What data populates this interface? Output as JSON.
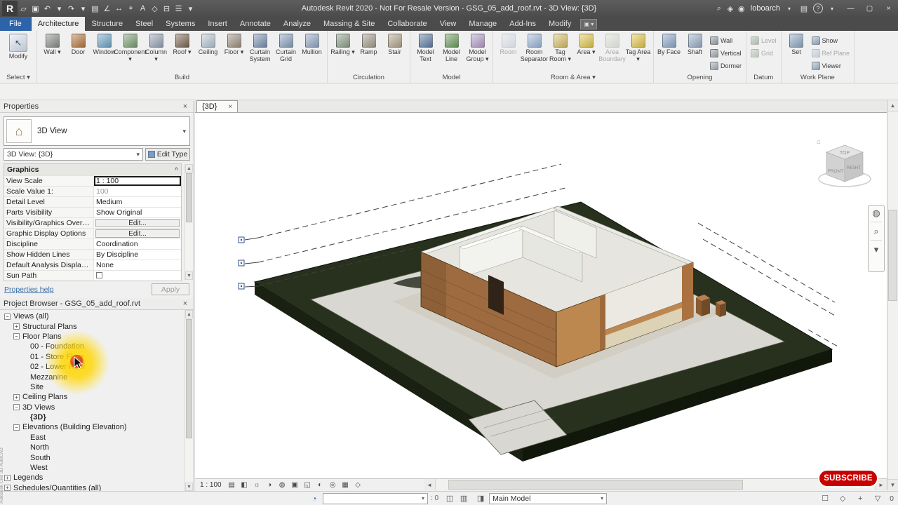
{
  "title_bar": {
    "title": "Autodesk Revit 2020 - Not For Resale Version - GSG_05_add_roof.rvt - 3D View: {3D}",
    "user": "loboarch",
    "qat": [
      {
        "name": "revit-menu-icon",
        "glyph": "R"
      },
      {
        "name": "open-icon",
        "glyph": "▱"
      },
      {
        "name": "save-icon",
        "glyph": "▣"
      },
      {
        "name": "undo-icon",
        "glyph": "↶"
      },
      {
        "name": "undo-dropdown-icon",
        "glyph": "▾"
      },
      {
        "name": "redo-icon",
        "glyph": "↷"
      },
      {
        "name": "redo-dropdown-icon",
        "glyph": "▾"
      },
      {
        "name": "print-icon",
        "glyph": "▤"
      },
      {
        "name": "measure-icon",
        "glyph": "∠"
      },
      {
        "name": "aligned-dimension-icon",
        "glyph": "↔"
      },
      {
        "name": "tag-icon",
        "glyph": "⌖"
      },
      {
        "name": "text-icon",
        "glyph": "A"
      },
      {
        "name": "default-3d-view-icon",
        "glyph": "◇"
      },
      {
        "name": "section-icon",
        "glyph": "⊟"
      },
      {
        "name": "thin-lines-icon",
        "glyph": "☰"
      },
      {
        "name": "qat-customize-icon",
        "glyph": "▾"
      }
    ],
    "right_icons": [
      {
        "name": "search-icon",
        "glyph": "⌕"
      },
      {
        "name": "communication-center-icon",
        "glyph": "◈"
      },
      {
        "name": "user-icon",
        "glyph": "◉"
      }
    ],
    "user_dropdown_glyph": "▾",
    "store_icon_glyph": "▤",
    "help_glyph": "?",
    "help_dropdown_glyph": "▾",
    "window_controls": [
      {
        "name": "minimize-button",
        "glyph": "—"
      },
      {
        "name": "maximize-button",
        "glyph": "▢"
      },
      {
        "name": "close-button",
        "glyph": "×"
      }
    ]
  },
  "ribbon": {
    "tabs": [
      "File",
      "Architecture",
      "Structure",
      "Steel",
      "Systems",
      "Insert",
      "Annotate",
      "Analyze",
      "Massing & Site",
      "Collaborate",
      "View",
      "Manage",
      "Add-Ins",
      "Modify"
    ],
    "active_tab": "Architecture",
    "panels": [
      {
        "label": "Select",
        "arrow": true,
        "items": [
          {
            "label": "Modify",
            "ic": "#dce6f2",
            "glyph": "↖",
            "wide": true
          }
        ]
      },
      {
        "label": "Build",
        "items": [
          {
            "label": "Wall",
            "arrow": true,
            "ic": "#8a8f8a"
          },
          {
            "label": "Door",
            "ic": "#b5793f"
          },
          {
            "label": "Window",
            "ic": "#6fa7c7"
          },
          {
            "label": "Component",
            "arrow": true,
            "ic": "#7a9f72"
          },
          {
            "label": "Column",
            "arrow": true,
            "ic": "#98a4b8"
          },
          {
            "label": "Roof",
            "arrow": true,
            "ic": "#7c6752"
          },
          {
            "label": "Ceiling",
            "ic": "#b9c7d4"
          },
          {
            "label": "Floor",
            "arrow": true,
            "ic": "#a09182"
          },
          {
            "label": "Curtain System",
            "ic": "#7b93b4"
          },
          {
            "label": "Curtain Grid",
            "ic": "#8aa3c0"
          },
          {
            "label": "Mullion",
            "ic": "#93a9c4"
          }
        ]
      },
      {
        "label": "Circulation",
        "items": [
          {
            "label": "Railing",
            "arrow": true,
            "ic": "#8fa08d"
          },
          {
            "label": "Ramp",
            "ic": "#a59d8f"
          },
          {
            "label": "Stair",
            "ic": "#b3a88e"
          }
        ]
      },
      {
        "label": "Model",
        "items": [
          {
            "label": "Model Text",
            "ic": "#5f7fa5"
          },
          {
            "label": "Model Line",
            "ic": "#6f9f5f"
          },
          {
            "label": "Model Group",
            "arrow": true,
            "ic": "#b59fc9"
          }
        ]
      },
      {
        "label": "Room & Area",
        "arrow": true,
        "items": [
          {
            "label": "Room",
            "gray": true,
            "ic": "#cdd8e8"
          },
          {
            "label": "Room Separator",
            "ic": "#9fb9da"
          },
          {
            "label": "Tag Room",
            "arrow": true,
            "ic": "#d9c06a"
          },
          {
            "label": "Area",
            "arrow": true,
            "ic": "#e3c94f"
          },
          {
            "label": "Area Boundary",
            "gray": true,
            "ic": "#c9d4c2"
          },
          {
            "label": "Tag Area",
            "arrow": true,
            "ic": "#e3c94f"
          }
        ]
      },
      {
        "label": "Opening",
        "items": [
          {
            "label": "By Face",
            "ic": "#8fa9c9"
          },
          {
            "label": "Shaft",
            "ic": "#9ab1c9"
          },
          {
            "type": "stack",
            "items": [
              {
                "label": "Wall",
                "ic": "#9aa5ad"
              },
              {
                "label": "Vertical",
                "ic": "#a3adb5"
              },
              {
                "label": "Dormer",
                "ic": "#aab3ba"
              }
            ]
          }
        ]
      },
      {
        "label": "Datum",
        "items": [
          {
            "type": "stack",
            "items": [
              {
                "label": "Level",
                "gray": true,
                "ic": "#6f8f6f"
              },
              {
                "label": "Grid",
                "gray": true,
                "ic": "#8fa98f"
              }
            ]
          }
        ]
      },
      {
        "label": "Work Plane",
        "items": [
          {
            "label": "Set",
            "ic": "#92aac4"
          },
          {
            "type": "stack",
            "items": [
              {
                "label": "Show",
                "ic": "#9fb5cc"
              },
              {
                "label": "Ref Plane",
                "gray": true,
                "ic": "#aebecf"
              },
              {
                "label": "Viewer",
                "ic": "#a5bacf"
              }
            ]
          }
        ]
      }
    ]
  },
  "properties": {
    "header": "Properties",
    "type_selector_label": "3D View",
    "instance_value": "3D View: {3D}",
    "edit_type_label": "Edit Type",
    "group_header": "Graphics",
    "group_collapse_glyph": "^",
    "rows": [
      {
        "label": "View Scale",
        "value": "1 : 100",
        "type": "selected"
      },
      {
        "label": "Scale Value    1:",
        "value": "100",
        "type": "disabled"
      },
      {
        "label": "Detail Level",
        "value": "Medium",
        "type": "text"
      },
      {
        "label": "Parts Visibility",
        "value": "Show Original",
        "type": "text"
      },
      {
        "label": "Visibility/Graphics Overrides",
        "value": "Edit...",
        "type": "button"
      },
      {
        "label": "Graphic Display Options",
        "value": "Edit...",
        "type": "button"
      },
      {
        "label": "Discipline",
        "value": "Coordination",
        "type": "text"
      },
      {
        "label": "Show Hidden Lines",
        "value": "By Discipline",
        "type": "text"
      },
      {
        "label": "Default Analysis Display St...",
        "value": "None",
        "type": "text"
      },
      {
        "label": "Sun Path",
        "value": "",
        "type": "checkbox"
      }
    ],
    "help_link": "Properties help",
    "apply_label": "Apply"
  },
  "project_browser": {
    "header": "Project Browser - GSG_05_add_roof.rvt",
    "items": [
      {
        "depth": 0,
        "exp": "-",
        "label": "Views (all)"
      },
      {
        "depth": 1,
        "exp": "+",
        "label": "Structural Plans"
      },
      {
        "depth": 1,
        "exp": "-",
        "label": "Floor Plans"
      },
      {
        "depth": 2,
        "label": "00 - Foundation"
      },
      {
        "depth": 2,
        "label": "01 - Store Floor"
      },
      {
        "depth": 2,
        "label": "02 - Lower Roof"
      },
      {
        "depth": 2,
        "label": "Mezzanine"
      },
      {
        "depth": 2,
        "label": "Site"
      },
      {
        "depth": 1,
        "exp": "+",
        "label": "Ceiling Plans"
      },
      {
        "depth": 1,
        "exp": "-",
        "label": "3D Views"
      },
      {
        "depth": 2,
        "label": "{3D}",
        "bold": true
      },
      {
        "depth": 1,
        "exp": "-",
        "label": "Elevations (Building Elevation)"
      },
      {
        "depth": 2,
        "label": "East"
      },
      {
        "depth": 2,
        "label": "North"
      },
      {
        "depth": 2,
        "label": "South"
      },
      {
        "depth": 2,
        "label": "West"
      },
      {
        "depth": 0,
        "exp": "+",
        "label": "Legends"
      },
      {
        "depth": 0,
        "exp": "+",
        "label": "Schedules/Quantities (all)"
      }
    ]
  },
  "drawing": {
    "tab_label": "{3D}",
    "tab_close_glyph": "×",
    "view_scale": "1 : 100",
    "viewcube": {
      "top": "TOP",
      "front": "FRONT",
      "right": "RIGHT",
      "home_glyph": "⌂"
    },
    "nav_icons": [
      {
        "name": "navigation-wheel-icon",
        "glyph": "◍"
      },
      {
        "name": "zoom-icon",
        "glyph": "⌕"
      },
      {
        "name": "zoom-dropdown-icon",
        "glyph": "▾"
      }
    ],
    "view_control_icons": [
      {
        "name": "detail-level-icon",
        "glyph": "▤"
      },
      {
        "name": "visual-style-icon",
        "glyph": "◧"
      },
      {
        "name": "sun-path-icon",
        "glyph": "☼"
      },
      {
        "name": "shadows-icon",
        "glyph": "◑"
      },
      {
        "name": "rendering-dialog-icon",
        "glyph": "◍"
      },
      {
        "name": "crop-view-icon",
        "glyph": "▣"
      },
      {
        "name": "show-crop-region-icon",
        "glyph": "◱"
      },
      {
        "name": "temporary-hide-isolate-icon",
        "glyph": "◐"
      },
      {
        "name": "reveal-hidden-elements-icon",
        "glyph": "◎"
      },
      {
        "name": "temporary-view-properties-icon",
        "glyph": "▦"
      },
      {
        "name": "displacement-sets-icon",
        "glyph": "◇"
      }
    ]
  },
  "status_bar": {
    "watermark": "Autodesk Civil 3D AutoCAD",
    "workset_icon_glyph": "◔",
    "workset_value": "",
    "requests_label": ": 0",
    "mid_icons": [
      {
        "name": "worksets-dialog-icon",
        "glyph": "◫"
      },
      {
        "name": "worksharing-display-icon",
        "glyph": "▥"
      }
    ],
    "design_option_icon_glyph": "◨",
    "design_option_value": "Main Model",
    "right_icons": [
      {
        "name": "editable-only-checkbox",
        "glyph": "☐"
      },
      {
        "name": "exclude-options-icon",
        "glyph": "◇"
      },
      {
        "name": "press-drag-icon",
        "glyph": "+"
      },
      {
        "name": "filter-icon",
        "glyph": "▽"
      }
    ],
    "selection_count": "0"
  },
  "subscribe_label": "SUBSCRIBE"
}
